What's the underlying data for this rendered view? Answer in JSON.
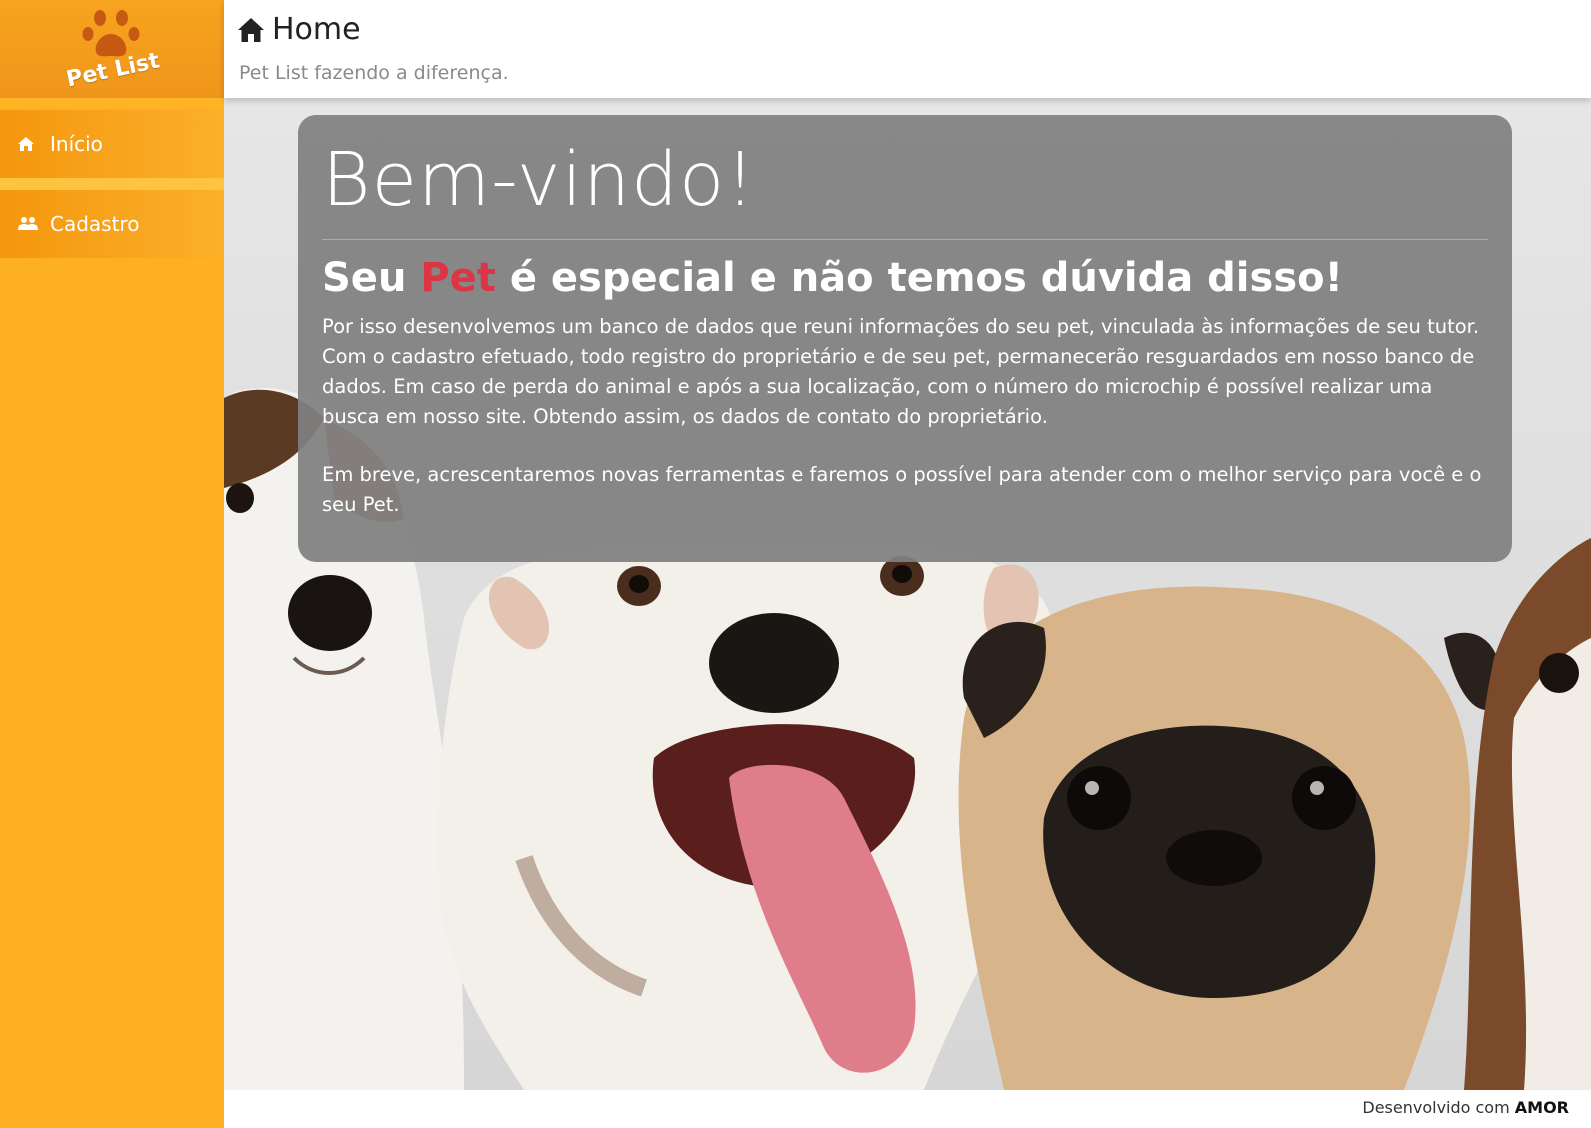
{
  "brand": {
    "name": "Pet List",
    "logo_icon": "paw-icon"
  },
  "sidebar": {
    "items": [
      {
        "label": "Início",
        "icon": "home-icon"
      },
      {
        "label": "Cadastro",
        "icon": "users-icon"
      }
    ]
  },
  "header": {
    "title": "Home",
    "icon": "home-icon",
    "subtitle": "Pet List fazendo a diferença."
  },
  "welcome": {
    "heading": "Bem-vindo!",
    "tagline_prefix": "Seu ",
    "tagline_highlight": "Pet",
    "tagline_suffix": " é especial e não temos dúvida disso!",
    "paragraph1": "Por isso desenvolvemos um banco de dados que reuni informações do seu pet, vinculada às informações de seu tutor. Com o cadastro efetuado, todo registro do proprietário e de seu pet, permanecerão resguardados em nosso banco de dados. Em caso de perda do animal e após a sua localização, com o número do microchip é possível realizar uma busca em nosso site. Obtendo assim, os dados de contato do proprietário.",
    "paragraph2": "Em breve, acrescentaremos novas ferramentas e faremos o possível para atender com o melhor serviço para você e o seu Pet."
  },
  "footer": {
    "prefix": "Desenvolvido com ",
    "brand": "AMOR"
  },
  "colors": {
    "sidebar": "#fdb022",
    "accent": "#f0951b",
    "highlight": "#dc3545",
    "card": "#808080"
  }
}
